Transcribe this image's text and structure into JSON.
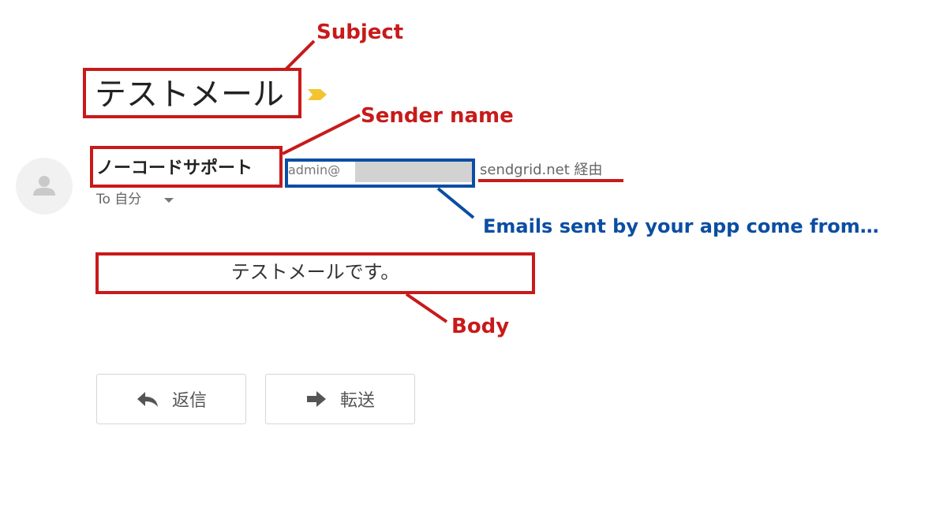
{
  "email": {
    "subject": "テストメール",
    "sender_name": "ノーコードサポート",
    "sender_email_prefix": "admin@",
    "via_text": "sendgrid.net 経由",
    "recipient": "To 自分",
    "body": "テストメールです。",
    "actions": {
      "reply_label": "返信",
      "forward_label": "転送"
    }
  },
  "annotations": {
    "subject_label": "Subject",
    "sender_name_label": "Sender name",
    "sender_email_note": "Emails sent by your app come from…",
    "body_label": "Body"
  },
  "colors": {
    "annotation_red": "#c81a1a",
    "annotation_blue": "#0b4ea2",
    "importance_marker": "#f4c430"
  }
}
